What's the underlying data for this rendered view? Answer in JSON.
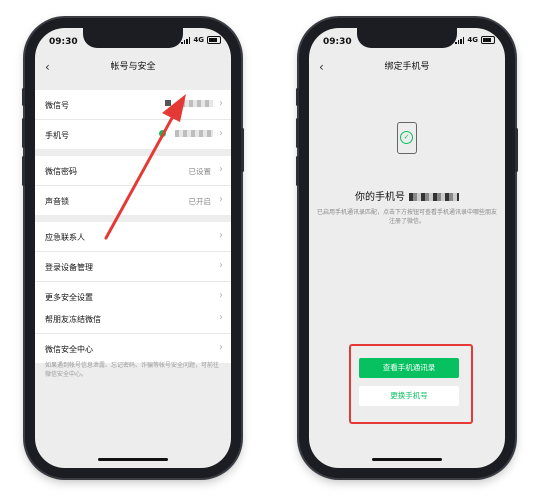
{
  "left_phone": {
    "status": {
      "time": "09:30",
      "network": "4G"
    },
    "nav": {
      "title": "帐号与安全",
      "back_icon": "chevron-left-icon"
    },
    "rows": [
      {
        "label": "微信号",
        "value": ""
      },
      {
        "label": "手机号",
        "value": ""
      },
      {
        "label": "微信密码",
        "value": "已设置"
      },
      {
        "label": "声音锁",
        "value": "已开启"
      },
      {
        "label": "应急联系人",
        "value": ""
      },
      {
        "label": "登录设备管理",
        "value": ""
      },
      {
        "label": "更多安全设置",
        "value": ""
      },
      {
        "label": "帮朋友冻结微信",
        "value": ""
      },
      {
        "label": "微信安全中心",
        "value": ""
      }
    ],
    "footnote": "如果遇到帐号信息泄露、忘记密码、诈骗等帐号安全问题，可前往微信安全中心。"
  },
  "right_phone": {
    "status": {
      "time": "09:30",
      "network": "4G"
    },
    "nav": {
      "title": "绑定手机号",
      "back_icon": "chevron-left-icon"
    },
    "your_number_label": "你的手机号",
    "description": "已启用手机通讯录匹配，点击下方按钮可查看手机通讯录中哪些朋友注册了微信。",
    "buttons": {
      "view_contacts": "查看手机通讯录",
      "change_number": "更换手机号"
    }
  },
  "colors": {
    "accent_green": "#07c160",
    "annotation_red": "#e53935"
  }
}
